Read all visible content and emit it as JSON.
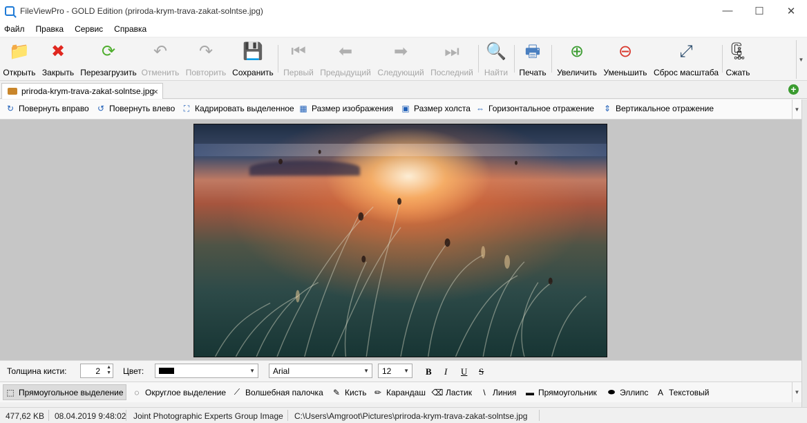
{
  "window": {
    "title": "FileViewPro - GOLD Edition (priroda-krym-trava-zakat-solntse.jpg)",
    "minimize": "—",
    "maximize": "☐",
    "close": "✕"
  },
  "menu": [
    "Файл",
    "Правка",
    "Сервис",
    "Справка"
  ],
  "toolbar": {
    "buttons": [
      {
        "label": "Открыть",
        "icon": "folder-icon",
        "glyph": "📁",
        "color": "#f0a524",
        "enabled": true
      },
      {
        "label": "Закрыть",
        "icon": "close-x-icon",
        "glyph": "✖",
        "color": "#e0271f",
        "enabled": true
      },
      {
        "label": "Перезагрузить",
        "icon": "reload-icon",
        "glyph": "⟳",
        "color": "#4fae2e",
        "enabled": true
      },
      {
        "label": "Отменить",
        "icon": "undo-icon",
        "glyph": "↶",
        "color": "#a8a8a8",
        "enabled": false
      },
      {
        "label": "Повторить",
        "icon": "redo-icon",
        "glyph": "↷",
        "color": "#a8a8a8",
        "enabled": false
      },
      {
        "label": "Сохранить",
        "icon": "floppy-icon",
        "glyph": "💾",
        "color": "#222222",
        "enabled": true
      },
      {
        "label": "Первый",
        "icon": "first-icon",
        "glyph": "⏮",
        "color": "#b0b0b0",
        "enabled": false
      },
      {
        "label": "Предыдущий",
        "icon": "previous-icon",
        "glyph": "⬅",
        "color": "#b0b0b0",
        "enabled": false
      },
      {
        "label": "Следующий",
        "icon": "next-icon",
        "glyph": "➡",
        "color": "#b0b0b0",
        "enabled": false
      },
      {
        "label": "Последний",
        "icon": "last-icon",
        "glyph": "⏭",
        "color": "#b0b0b0",
        "enabled": false
      },
      {
        "label": "Найти",
        "icon": "find-icon",
        "glyph": "🔍",
        "color": "#b0b0b0",
        "enabled": false
      },
      {
        "label": "Печать",
        "icon": "printer-icon",
        "glyph": "🖶",
        "color": "#4a7fc0",
        "enabled": true
      },
      {
        "label": "Увеличить",
        "icon": "zoom-in-icon",
        "glyph": "⊕",
        "color": "#3a9b2f",
        "enabled": true
      },
      {
        "label": "Уменьшить",
        "icon": "zoom-out-icon",
        "glyph": "⊖",
        "color": "#d9372c",
        "enabled": true
      },
      {
        "label": "Сброс масштаба",
        "icon": "reset-zoom-icon",
        "glyph": "⤢",
        "color": "#2f4f6f",
        "enabled": true
      },
      {
        "label": "Сжать",
        "icon": "zip-icon",
        "glyph": "🗜",
        "color": "#222222",
        "enabled": true
      }
    ]
  },
  "tab": {
    "title": "priroda-krym-trava-zakat-solntse.jpg",
    "close": "×",
    "new_tab": "+"
  },
  "edit_toolbar": [
    {
      "label": "Повернуть вправо",
      "icon": "rotate-right-icon",
      "glyph": "↻"
    },
    {
      "label": "Повернуть влево",
      "icon": "rotate-left-icon",
      "glyph": "↺"
    },
    {
      "label": "Кадрировать выделенное",
      "icon": "crop-icon",
      "glyph": "⛶"
    },
    {
      "label": "Размер изображения",
      "icon": "image-size-icon",
      "glyph": "▦"
    },
    {
      "label": "Размер холста",
      "icon": "canvas-size-icon",
      "glyph": "▣"
    },
    {
      "label": "Горизонтальное отражение",
      "icon": "flip-horizontal-icon",
      "glyph": "⇔"
    },
    {
      "label": "Вертикальное отражение",
      "icon": "flip-vertical-icon",
      "glyph": "⇕"
    }
  ],
  "settings": {
    "brush_label": "Толщина кисти:",
    "brush_value": "2",
    "color_label": "Цвет:",
    "color_value": "#000000",
    "font_name": "Arial",
    "font_size": "12",
    "bold": "B",
    "italic": "I",
    "underline": "U",
    "strike": "S"
  },
  "tools": [
    {
      "label": "Прямоугольное выделение",
      "icon": "rect-select-icon",
      "glyph": "⬚",
      "active": true
    },
    {
      "label": "Округлое выделение",
      "icon": "ellipse-select-icon",
      "glyph": "◌",
      "active": false
    },
    {
      "label": "Волшебная палочка",
      "icon": "magic-wand-icon",
      "glyph": "⟋",
      "active": false
    },
    {
      "label": "Кисть",
      "icon": "brush-icon",
      "glyph": "✎",
      "active": false
    },
    {
      "label": "Карандаш",
      "icon": "pencil-icon",
      "glyph": "✏",
      "active": false
    },
    {
      "label": "Ластик",
      "icon": "eraser-icon",
      "glyph": "⌫",
      "active": false
    },
    {
      "label": "Линия",
      "icon": "line-icon",
      "glyph": "\\",
      "active": false
    },
    {
      "label": "Прямоугольник",
      "icon": "rectangle-icon",
      "glyph": "▬",
      "active": false
    },
    {
      "label": "Эллипс",
      "icon": "ellipse-icon",
      "glyph": "⬬",
      "active": false
    },
    {
      "label": "Текстовый",
      "icon": "text-icon",
      "glyph": "A",
      "active": false
    }
  ],
  "status": {
    "size": "477,62 KB",
    "date": "08.04.2019 9:48:02",
    "type": "Joint Photographic Experts Group Image",
    "path": "C:\\Users\\Amgroot\\Pictures\\priroda-krym-trava-zakat-solntse.jpg"
  }
}
